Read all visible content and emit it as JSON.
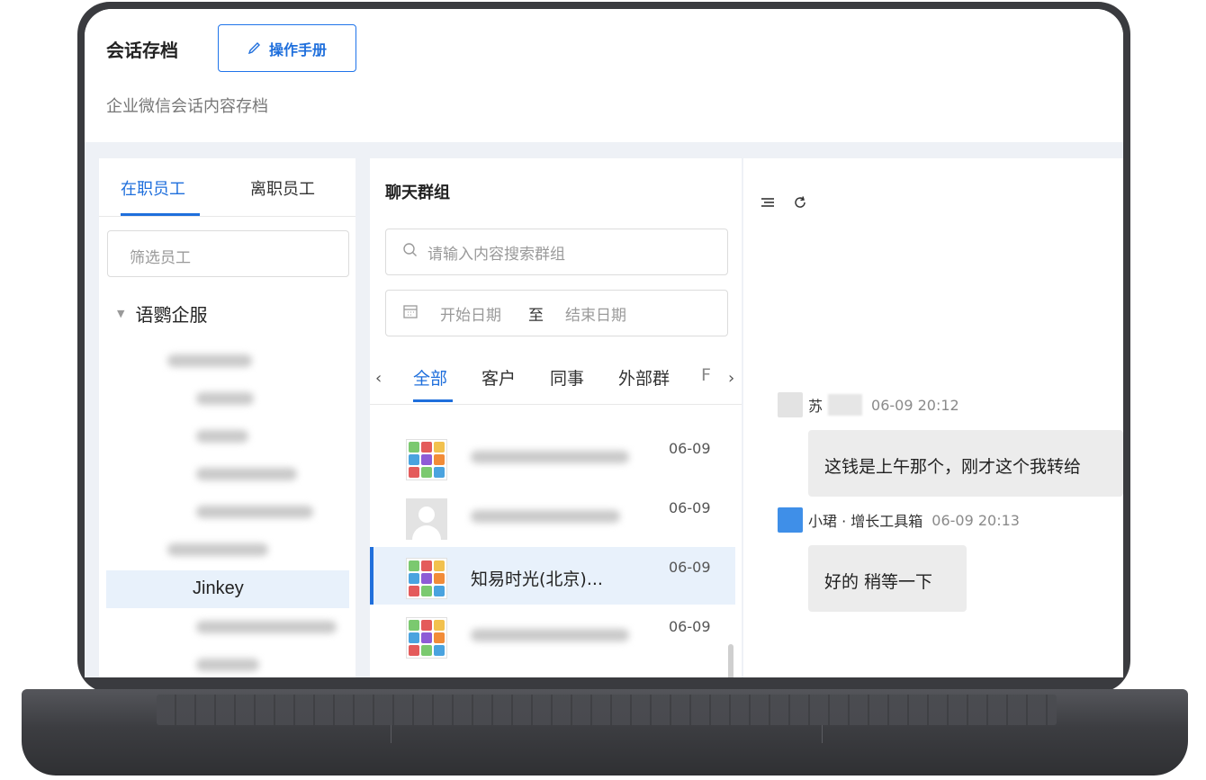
{
  "header": {
    "title": "会话存档",
    "manual_button": "操作手册",
    "subtitle": "企业微信会话内容存档"
  },
  "employees": {
    "tabs": [
      "在职员工",
      "离职员工"
    ],
    "active_tab": 0,
    "filter_placeholder": "筛选员工",
    "tree_root": "语鹦企服",
    "selected_employee": "Jinkey"
  },
  "groups": {
    "title": "聊天群组",
    "search_placeholder": "请输入内容搜索群组",
    "date_start_placeholder": "开始日期",
    "date_separator": "至",
    "date_end_placeholder": "结束日期",
    "categories": [
      "全部",
      "客户",
      "同事",
      "外部群",
      "F"
    ],
    "active_category": 0,
    "items": [
      {
        "name": "",
        "date": "06-09",
        "avatar": "grid",
        "selected": false
      },
      {
        "name": "",
        "date": "06-09",
        "avatar": "blank",
        "selected": false
      },
      {
        "name": "知易时光(北京)...",
        "date": "06-09",
        "avatar": "grid",
        "selected": true
      },
      {
        "name": "",
        "date": "06-09",
        "avatar": "grid",
        "selected": false
      }
    ]
  },
  "chat": {
    "tool_icons": [
      "menu-list-icon",
      "refresh-icon"
    ],
    "messages": [
      {
        "sender": "苏",
        "time": "06-09 20:12",
        "text": "这钱是上午那个，刚才这个我转给"
      },
      {
        "sender": "小珺 · 增长工具箱",
        "time": "06-09 20:13",
        "text": "好的 稍等一下"
      }
    ]
  },
  "colors": {
    "accent": "#1f6fdc",
    "selected_row": "#e8f1fb",
    "content_background": "#eef1f6",
    "bubble": "#ececec",
    "laptop_frame": "#3a3b3f"
  }
}
